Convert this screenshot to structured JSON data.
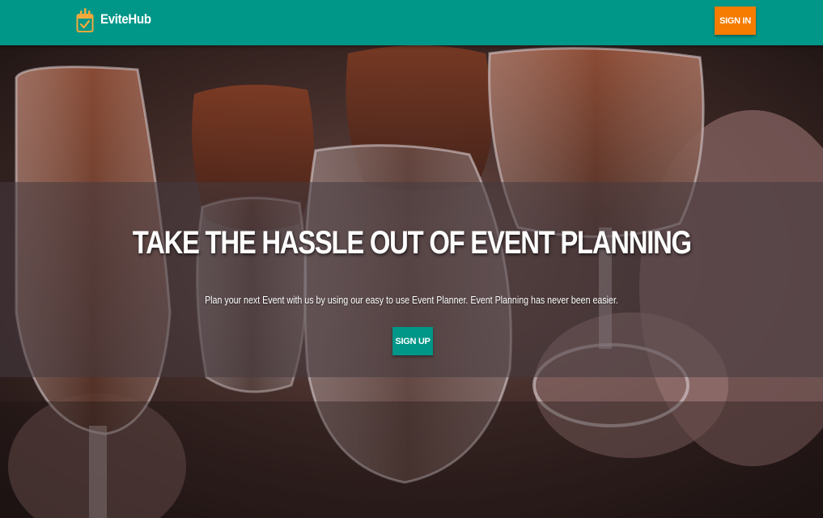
{
  "navbar": {
    "brand_name": "EviteHub",
    "brand_icon": "calendar-check-icon",
    "signin_label": "SIGN IN",
    "background_color": "#009688",
    "signin_color": "#f57c00"
  },
  "hero": {
    "background_image": "toasting-glasses-photo",
    "headline": "TAKE THE HASSLE OUT OF EVENT PLANNING",
    "subtext": "Plan your next Event with us by using our easy to use Event Planner. Event Planning has never been easier.",
    "signup_label": "SIGN UP",
    "signup_color": "#009688"
  }
}
